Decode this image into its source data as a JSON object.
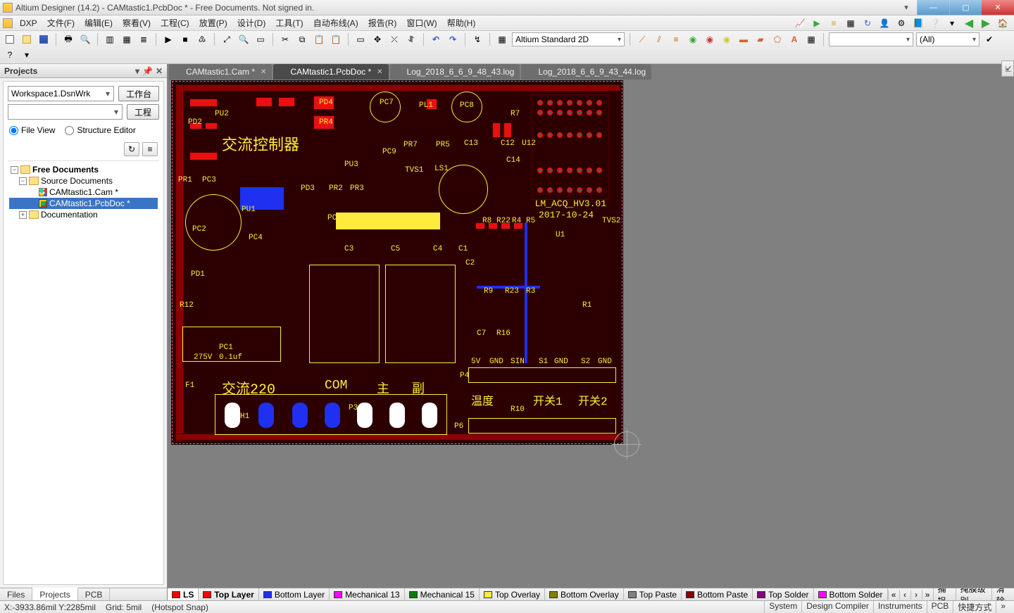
{
  "window": {
    "title": "Altium Designer (14.2) - CAMtastic1.PcbDoc * - Free Documents. Not signed in."
  },
  "menus": {
    "dxp": "DXP",
    "items": [
      "文件(F)",
      "编辑(E)",
      "察看(V)",
      "工程(C)",
      "放置(P)",
      "设计(D)",
      "工具(T)",
      "自动布线(A)",
      "报告(R)",
      "窗口(W)",
      "帮助(H)"
    ]
  },
  "toolbar": {
    "view_combo": "Altium Standard 2D",
    "filter_combo": "",
    "all_combo": "(All)"
  },
  "projects": {
    "panel_title": "Projects",
    "workspace": "Workspace1.DsnWrk",
    "btn_workspace": "工作台",
    "btn_project": "工程",
    "radio_file": "File View",
    "radio_structure": "Structure Editor",
    "tree": {
      "root": "Free Documents",
      "source": "Source Documents",
      "cam": "CAMtastic1.Cam *",
      "pcb": "CAMtastic1.PcbDoc *",
      "docfolder": "Documentation"
    },
    "bottom_tabs": [
      "Files",
      "Projects",
      "PCB"
    ]
  },
  "doc_tabs": [
    {
      "label": "CAMtastic1.Cam *",
      "active": false,
      "icon": "cam"
    },
    {
      "label": "CAMtastic1.PcbDoc *",
      "active": true,
      "icon": "pcb"
    },
    {
      "label": "Log_2018_6_6_9_48_43.log",
      "active": false,
      "icon": "doc"
    },
    {
      "label": "Log_2018_6_6_9_43_44.log",
      "active": false,
      "icon": "doc"
    }
  ],
  "layers": {
    "ls": "LS",
    "list": [
      {
        "name": "Top Layer",
        "color": "#ff0000",
        "bold": true
      },
      {
        "name": "Bottom Layer",
        "color": "#2030f0"
      },
      {
        "name": "Mechanical 13",
        "color": "#ff00ff"
      },
      {
        "name": "Mechanical 15",
        "color": "#008000"
      },
      {
        "name": "Top Overlay",
        "color": "#ffeb3b"
      },
      {
        "name": "Bottom Overlay",
        "color": "#808000"
      },
      {
        "name": "Top Paste",
        "color": "#808080"
      },
      {
        "name": "Bottom Paste",
        "color": "#800000"
      },
      {
        "name": "Top Solder",
        "color": "#800080"
      },
      {
        "name": "Bottom Solder",
        "color": "#ff00ff"
      }
    ],
    "rtabs": [
      "捕捉",
      "掩膜级别",
      "清除"
    ]
  },
  "status": {
    "coords": "X:-3933.86mil Y:2285mil",
    "grid": "Grid: 5mil",
    "snap": "(Hotspot Snap)",
    "right": [
      "System",
      "Design Compiler",
      "Instruments",
      "PCB",
      "快捷方式"
    ]
  },
  "vtab": "⇲",
  "pcb": {
    "text_main": "交流控制器",
    "text_board": "LM_ACQ_HV3.01",
    "text_date": "2017-10-24",
    "text_220": "交流220",
    "text_com": "COM",
    "text_main2": "主",
    "text_aux": "副",
    "text_temp": "温度",
    "text_sw1": "开关1",
    "text_sw2": "开关2",
    "conn": [
      "5V",
      "GND",
      "SIN",
      "S1",
      "GND",
      "S2",
      "GND"
    ],
    "refs": [
      "PD2",
      "PU2",
      "PD4",
      "PR4",
      "PC7",
      "PL1",
      "PC8",
      "R7",
      "C12",
      "U12",
      "C13",
      "C14",
      "PR1",
      "PC3",
      "PD3",
      "PR2",
      "PR3",
      "TVS1",
      "LS1",
      "PU1",
      "PC5",
      "PC4",
      "PD1",
      "R12",
      "F1",
      "PC1",
      "H1",
      "P3",
      "P4",
      "P6",
      "PU3",
      "PR5",
      "PR7",
      "PC9",
      "C3",
      "C4",
      "C5",
      "C1",
      "C2",
      "R8",
      "R22",
      "R4",
      "R5",
      "R9",
      "R23",
      "R3",
      "R16",
      "C7",
      "R1",
      "R10",
      "TVS2",
      "U1",
      "PC2",
      "275V",
      "0.1uf"
    ]
  }
}
